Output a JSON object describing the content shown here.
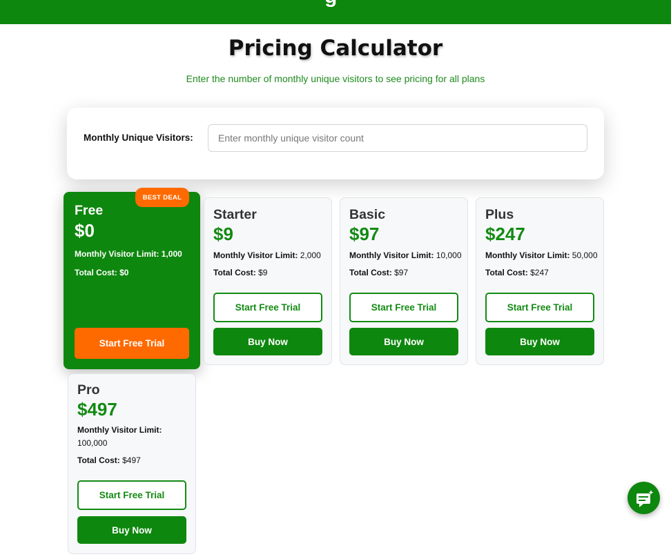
{
  "header": {
    "partial_title": "g"
  },
  "page": {
    "title": "Pricing Calculator",
    "subtitle": "Enter the number of monthly unique visitors to see pricing for all plans"
  },
  "calculator": {
    "label": "Monthly Unique Visitors:",
    "placeholder": "Enter monthly unique visitor count",
    "value": ""
  },
  "plans": [
    {
      "name": "Free",
      "price": "$0",
      "limit_label": "Monthly Visitor Limit:",
      "limit_value": "1,000",
      "cost_label": "Total Cost:",
      "cost_value": "$0",
      "badge": "BEST DEAL",
      "trial_label": "Start Free Trial"
    },
    {
      "name": "Starter",
      "price": "$9",
      "limit_label": "Monthly Visitor Limit:",
      "limit_value": "2,000",
      "cost_label": "Total Cost:",
      "cost_value": "$9",
      "trial_label": "Start Free Trial",
      "buy_label": "Buy Now"
    },
    {
      "name": "Basic",
      "price": "$97",
      "limit_label": "Monthly Visitor Limit:",
      "limit_value": "10,000",
      "cost_label": "Total Cost:",
      "cost_value": "$97",
      "trial_label": "Start Free Trial",
      "buy_label": "Buy Now"
    },
    {
      "name": "Plus",
      "price": "$247",
      "limit_label": "Monthly Visitor Limit:",
      "limit_value": "50,000",
      "cost_label": "Total Cost:",
      "cost_value": "$247",
      "trial_label": "Start Free Trial",
      "buy_label": "Buy Now"
    },
    {
      "name": "Pro",
      "price": "$497",
      "limit_label": "Monthly Visitor Limit:",
      "limit_value": "100,000",
      "cost_label": "Total Cost:",
      "cost_value": "$497",
      "trial_label": "Start Free Trial",
      "buy_label": "Buy Now"
    }
  ],
  "chat": {
    "icon": "chat-sparkle-icon"
  },
  "colors": {
    "brand_green": "#0e870e",
    "accent_orange": "#ff6a00",
    "price_green": "#138a13"
  }
}
